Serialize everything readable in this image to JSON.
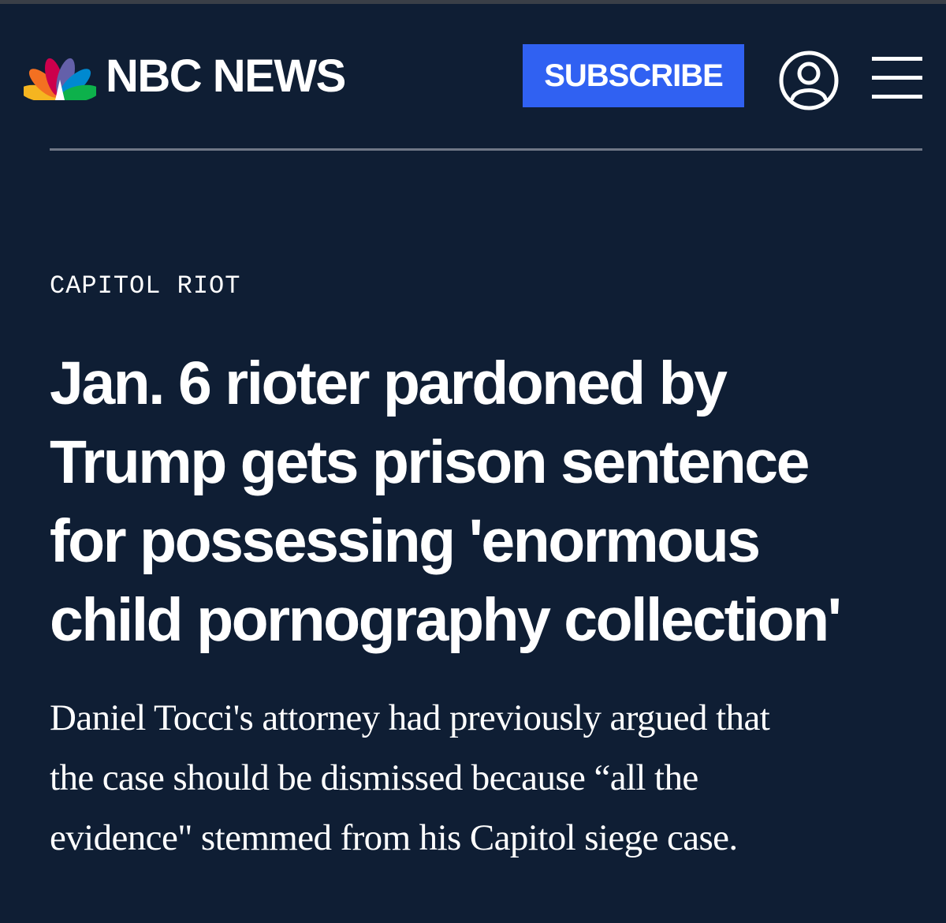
{
  "brand": {
    "name": "NBC NEWS",
    "peacock_colors": [
      "#f5b520",
      "#f37021",
      "#cc004c",
      "#6460aa",
      "#0089d0",
      "#0db14b"
    ]
  },
  "header": {
    "subscribe_label": "SUBSCRIBE",
    "subscribe_color": "#3061f2",
    "account_icon": "user-circle-icon",
    "menu_icon": "hamburger-menu-icon"
  },
  "article": {
    "section": "CAPITOL RIOT",
    "headline_lines": [
      "Jan. 6 rioter pardoned by",
      "Trump gets prison sentence",
      "for possessing 'enormous",
      "child pornography collection'"
    ],
    "dek_lines": [
      "Daniel Tocci's attorney had previously argued that",
      "the case should be dismissed because “all the",
      "evidence\" stemmed from his Capitol siege case."
    ]
  },
  "theme": {
    "background": "#0f1e34",
    "text": "#ffffff",
    "divider": "#6f7786"
  }
}
